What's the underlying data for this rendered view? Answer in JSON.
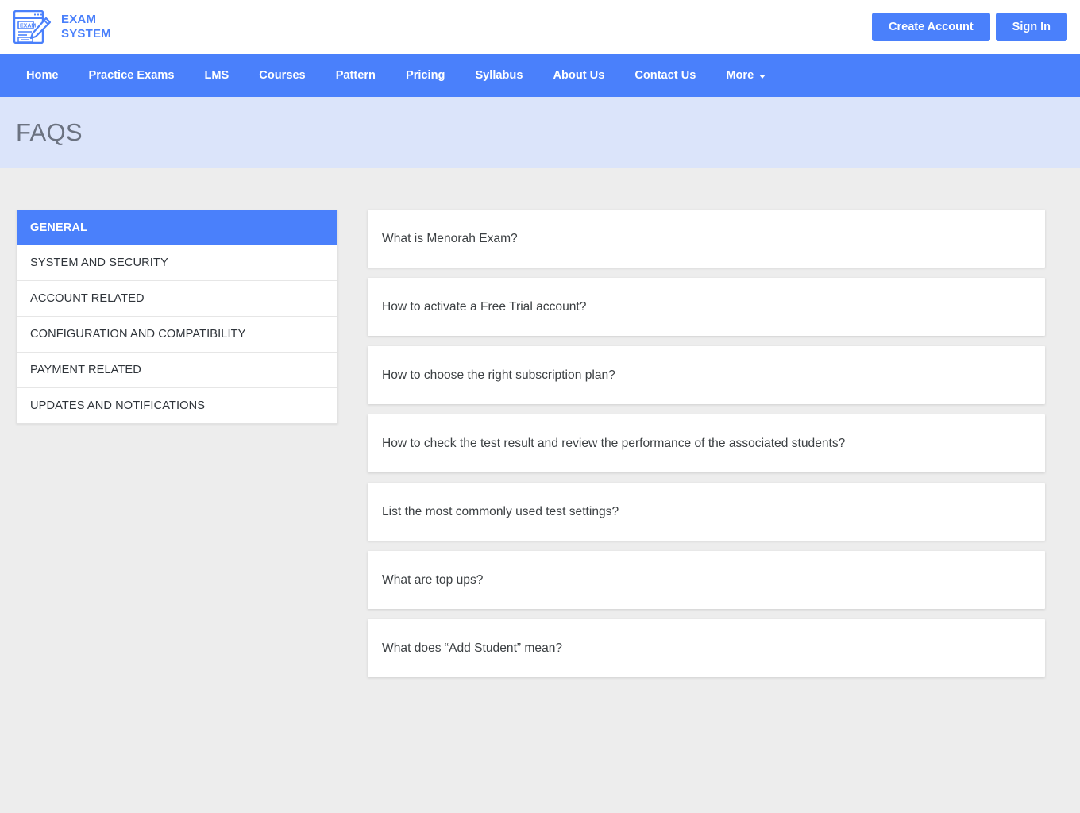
{
  "header": {
    "brand": {
      "logo_icon": "exam-document-pencil-icon",
      "line1": "EXAM",
      "line2": "SYSTEM"
    },
    "create_account_label": "Create Account",
    "sign_in_label": "Sign In"
  },
  "navbar": {
    "items": [
      {
        "label": "Home",
        "has_caret": false
      },
      {
        "label": "Practice Exams",
        "has_caret": false
      },
      {
        "label": "LMS",
        "has_caret": false
      },
      {
        "label": "Courses",
        "has_caret": false
      },
      {
        "label": "Pattern",
        "has_caret": false
      },
      {
        "label": "Pricing",
        "has_caret": false
      },
      {
        "label": "Syllabus",
        "has_caret": false
      },
      {
        "label": "About Us",
        "has_caret": false
      },
      {
        "label": "Contact Us",
        "has_caret": false
      },
      {
        "label": "More",
        "has_caret": true
      }
    ]
  },
  "banner": {
    "title": "FAQS"
  },
  "sidebar": {
    "categories": [
      {
        "label": "GENERAL",
        "active": true
      },
      {
        "label": "SYSTEM AND SECURITY",
        "active": false
      },
      {
        "label": "ACCOUNT RELATED",
        "active": false
      },
      {
        "label": "CONFIGURATION AND COMPATIBILITY",
        "active": false
      },
      {
        "label": "PAYMENT RELATED",
        "active": false
      },
      {
        "label": "UPDATES AND NOTIFICATIONS",
        "active": false
      }
    ]
  },
  "faqs": {
    "questions": [
      "What is Menorah Exam?",
      "How to activate a Free Trial account?",
      "How to choose the right subscription plan?",
      "How to check the test result and review the performance of the associated students?",
      "List the most commonly used test settings?",
      "What are top ups?",
      "What does “Add Student” mean?"
    ]
  },
  "colors": {
    "brand_blue": "#4a80fb",
    "banner_bg": "#dbe4fa",
    "page_bg": "#ededed",
    "card_bg": "#ffffff",
    "text_dark": "#3c4043",
    "title_gray": "#6b7280"
  }
}
